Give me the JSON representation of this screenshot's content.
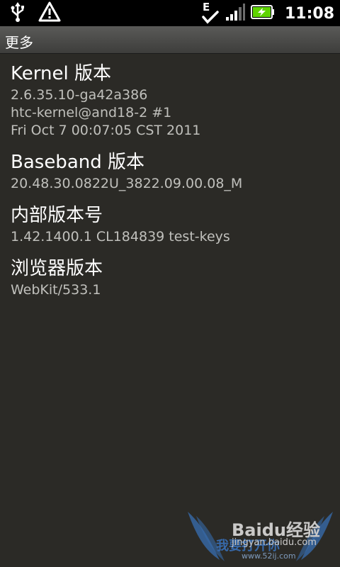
{
  "status_bar": {
    "time": "11:08",
    "network_type": "E",
    "icons": [
      "usb-icon",
      "warning-icon",
      "network-e-icon",
      "signal-icon",
      "battery-charging-icon"
    ]
  },
  "title_bar": {
    "title": "更多"
  },
  "sections": [
    {
      "title": "Kernel 版本",
      "lines": [
        "2.6.35.10-ga42a386",
        "htc-kernel@and18-2 #1",
        "Fri Oct 7 00:07:05 CST 2011"
      ]
    },
    {
      "title": "Baseband 版本",
      "lines": [
        "20.48.30.0822U_3822.09.00.08_M"
      ]
    },
    {
      "title": "内部版本号",
      "lines": [
        "1.42.1400.1 CL184839 test-keys"
      ]
    },
    {
      "title": "浏览器版本",
      "lines": [
        "WebKit/533.1"
      ]
    }
  ],
  "watermark": {
    "brand": "Baidu经验",
    "url": "jingyan.baidu.com",
    "slogan": "我要打开你",
    "subline": "www.52ij.com"
  },
  "colors": {
    "background": "#2b2a26",
    "status_bar": "#000000",
    "battery_green": "#5fd400",
    "watermark_blue": "#3b7fd6"
  }
}
